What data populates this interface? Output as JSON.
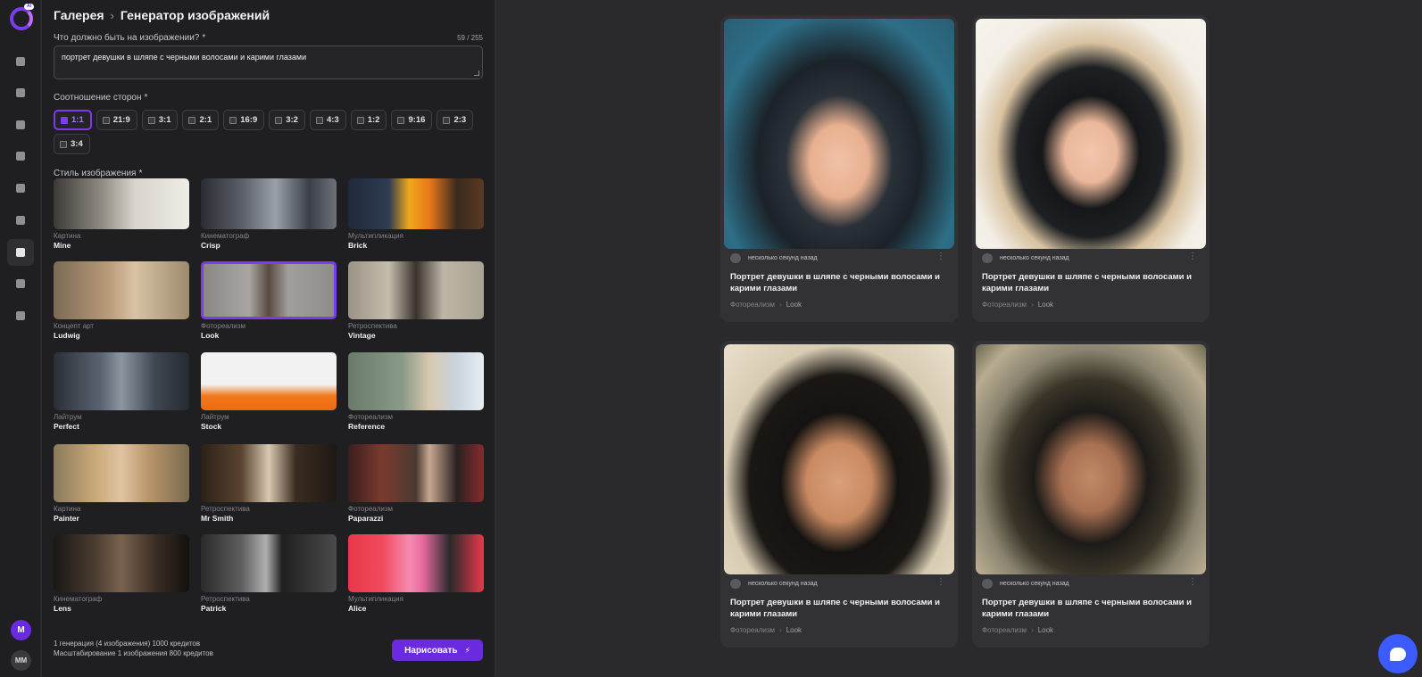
{
  "breadcrumb": {
    "root": "Галерея",
    "current": "Генератор изображений"
  },
  "logo_badge": "AI",
  "prompt": {
    "label": "Что должно быть на изображении?",
    "required": "*",
    "counter": "59 / 255",
    "value": "портрет девушки в шляпе с черными волосами и карими глазами"
  },
  "ratio": {
    "label": "Соотношение сторон",
    "required": "*",
    "options": [
      "1:1",
      "21:9",
      "3:1",
      "2:1",
      "16:9",
      "3:2",
      "4:3",
      "1:2",
      "9:16",
      "2:3",
      "3:4"
    ],
    "selected": "1:1"
  },
  "style": {
    "label": "Стиль изображения",
    "required": "*",
    "items": [
      {
        "category": "Картина",
        "name": "Mine"
      },
      {
        "category": "Кинематограф",
        "name": "Crisp"
      },
      {
        "category": "Мультипликация",
        "name": "Brick"
      },
      {
        "category": "Концепт арт",
        "name": "Ludwig"
      },
      {
        "category": "Фотореализм",
        "name": "Look"
      },
      {
        "category": "Ретроспектива",
        "name": "Vintage"
      },
      {
        "category": "Лайтрум",
        "name": "Perfect"
      },
      {
        "category": "Лайтрум",
        "name": "Stock"
      },
      {
        "category": "Фотореализм",
        "name": "Reference"
      },
      {
        "category": "Картина",
        "name": "Painter"
      },
      {
        "category": "Ретроспектива",
        "name": "Mr Smith"
      },
      {
        "category": "Фотореализм",
        "name": "Paparazzi"
      },
      {
        "category": "Кинематограф",
        "name": "Lens"
      },
      {
        "category": "Ретроспектива",
        "name": "Patrick"
      },
      {
        "category": "Мультипликация",
        "name": "Alice"
      }
    ],
    "selected": "Look"
  },
  "footer": {
    "line1": "1 генерация (4 изображения) 1000 кредитов",
    "line2": "Масштабирование 1 изображения 800 кредитов",
    "draw_button": "Нарисовать"
  },
  "user": {
    "avatar_initial": "M",
    "avatar_initials": "MM"
  },
  "gallery": [
    {
      "time": "несколько секунд назад",
      "title": "Портрет девушки в шляпе с черными волосами и карими глазами",
      "category": "Фотореализм",
      "style": "Look"
    },
    {
      "time": "несколько секунд назад",
      "title": "Портрет девушки в шляпе с черными волосами и карими глазами",
      "category": "Фотореализм",
      "style": "Look"
    },
    {
      "time": "несколько секунд назад",
      "title": "Портрет девушки в шляпе с черными волосами и карими глазами",
      "category": "Фотореализм",
      "style": "Look"
    },
    {
      "time": "несколько секунд назад",
      "title": "Портрет девушки в шляпе с черными волосами и карими глазами",
      "category": "Фотореализм",
      "style": "Look"
    }
  ],
  "colors": {
    "accent": "#6a2be0",
    "accent_light": "#7b3cf0",
    "chat": "#3b5bff",
    "bg": "#2a2a2c",
    "panel": "#1f1f21"
  }
}
